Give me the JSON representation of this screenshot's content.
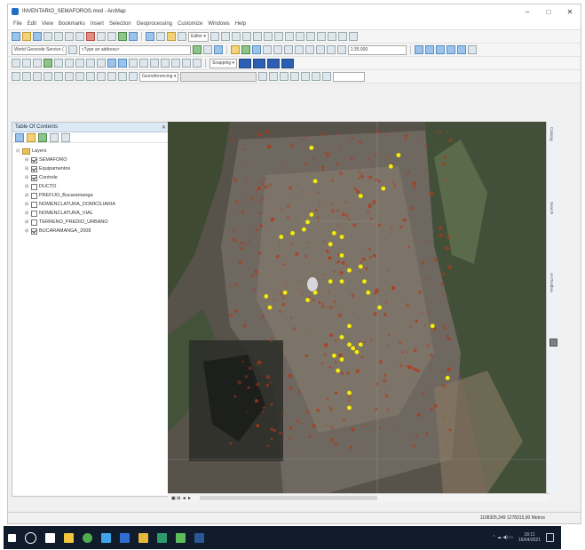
{
  "window": {
    "title": "INVENTARIO_SEMAFOROS.mxd - ArcMap",
    "controls": {
      "minimize": "–",
      "maximize": "□",
      "close": "✕"
    }
  },
  "menu": [
    "File",
    "Edit",
    "View",
    "Bookmarks",
    "Insert",
    "Selection",
    "Geoprocessing",
    "Customize",
    "Windows",
    "Help"
  ],
  "toolbar": {
    "editor_label": "Editor ▾",
    "locator_value": "World Geocode Service (",
    "address_placeholder": "<Type an address>",
    "scale_value": "1:35.000",
    "snapping_label": "Snapping ▾",
    "georef_label": "Georeferencing ▾"
  },
  "toc": {
    "title": "Table Of Contents",
    "close_glyph": "✕",
    "root_label": "Layers",
    "layers": [
      {
        "name": "SEMAFORO",
        "checked": true
      },
      {
        "name": "Equipamentos",
        "checked": true
      },
      {
        "name": "Controle",
        "checked": true
      },
      {
        "name": "DUCTO",
        "checked": false
      },
      {
        "name": "PREFIJO_Bucaramanga",
        "checked": false
      },
      {
        "name": "NOMENCLATURA_DOMICILIARIA",
        "checked": false
      },
      {
        "name": "NOMENCLATURA_VIAL",
        "checked": false
      },
      {
        "name": "TERRENO_PREDIO_URBANO",
        "checked": false
      },
      {
        "name": "BUCARAMANGA_2008",
        "checked": true
      }
    ]
  },
  "map": {
    "point_color": "#f3ea1c",
    "signal_color": "#b03818",
    "points": [
      [
        0.38,
        0.07
      ],
      [
        0.61,
        0.09
      ],
      [
        0.59,
        0.12
      ],
      [
        0.39,
        0.16
      ],
      [
        0.57,
        0.18
      ],
      [
        0.51,
        0.2
      ],
      [
        0.38,
        0.25
      ],
      [
        0.37,
        0.27
      ],
      [
        0.36,
        0.29
      ],
      [
        0.33,
        0.3
      ],
      [
        0.3,
        0.31
      ],
      [
        0.44,
        0.3
      ],
      [
        0.46,
        0.31
      ],
      [
        0.43,
        0.33
      ],
      [
        0.46,
        0.36
      ],
      [
        0.48,
        0.4
      ],
      [
        0.51,
        0.39
      ],
      [
        0.52,
        0.43
      ],
      [
        0.46,
        0.43
      ],
      [
        0.43,
        0.43
      ],
      [
        0.39,
        0.46
      ],
      [
        0.37,
        0.48
      ],
      [
        0.31,
        0.46
      ],
      [
        0.26,
        0.47
      ],
      [
        0.27,
        0.5
      ],
      [
        0.53,
        0.46
      ],
      [
        0.48,
        0.55
      ],
      [
        0.46,
        0.58
      ],
      [
        0.48,
        0.6
      ],
      [
        0.49,
        0.61
      ],
      [
        0.51,
        0.6
      ],
      [
        0.5,
        0.62
      ],
      [
        0.44,
        0.63
      ],
      [
        0.46,
        0.64
      ],
      [
        0.45,
        0.67
      ],
      [
        0.48,
        0.73
      ],
      [
        0.48,
        0.77
      ],
      [
        0.56,
        0.5
      ],
      [
        0.7,
        0.55
      ],
      [
        0.74,
        0.69
      ]
    ]
  },
  "map_footer": {
    "nav": "▣ ⊞ ◄ ►"
  },
  "status": {
    "coordinates": "1108305,349  1278315,90 Metros"
  },
  "taskbar": {
    "icons": [
      {
        "name": "start",
        "color": "#ffffff"
      },
      {
        "name": "search",
        "color": "#ffffff"
      },
      {
        "name": "task-view",
        "color": "#ffffff"
      },
      {
        "name": "file-explorer",
        "color": "#f2c53d"
      },
      {
        "name": "chrome",
        "color": "#4cae4f"
      },
      {
        "name": "arcgis",
        "color": "#3fa5e8"
      },
      {
        "name": "arccatalog",
        "color": "#2f6fd1"
      },
      {
        "name": "toolbox",
        "color": "#e6b73a"
      },
      {
        "name": "arcmap",
        "color": "#2e9b6d"
      },
      {
        "name": "calculator",
        "color": "#5ebd5a"
      },
      {
        "name": "word",
        "color": "#2b5797"
      }
    ],
    "tray_symbols": "⌃  ☁  ◀)  ▭",
    "time": "18:11",
    "date": "16/04/2021"
  }
}
